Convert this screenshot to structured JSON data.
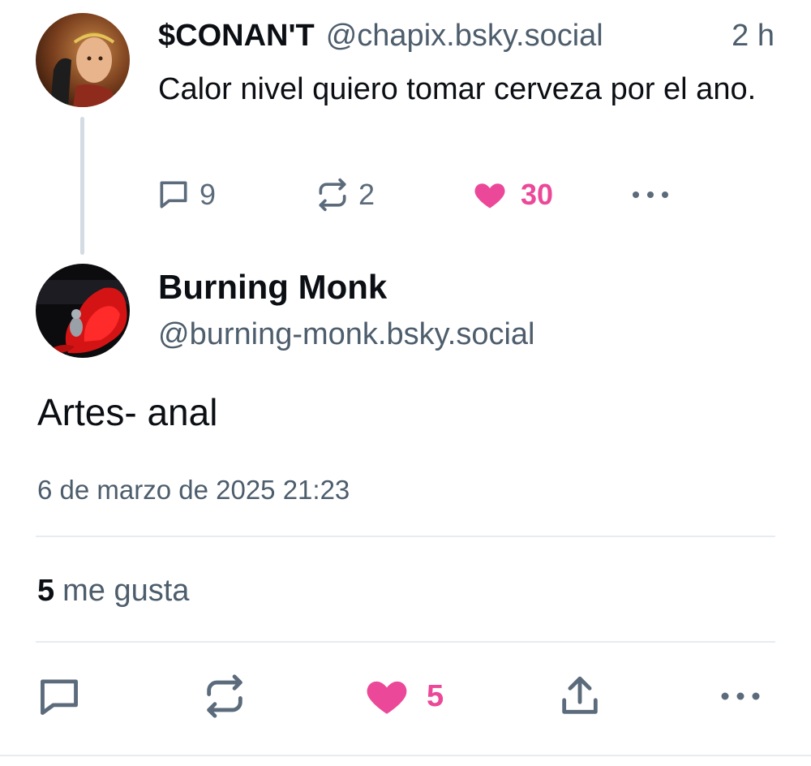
{
  "parent_post": {
    "display_name": "$CONAN'T",
    "handle": "@chapix.bsky.social",
    "time": "2 h",
    "text": "Calor nivel quiero tomar cerveza por el ano.",
    "reply_count": "9",
    "repost_count": "2",
    "like_count": "30",
    "liked": true
  },
  "main_post": {
    "display_name": "Burning Monk",
    "handle": "@burning-monk.bsky.social",
    "text": "Artes- anal",
    "datetime": "6 de marzo de 2025 21:23",
    "likes_count": "5",
    "likes_label": "me gusta",
    "action_like_count": "5",
    "liked": true
  },
  "icons": {
    "reply": "comment-bubble-icon",
    "repost": "repost-arrows-icon",
    "like": "heart-icon",
    "share": "share-upload-icon",
    "more": "more-dots-icon"
  },
  "colors": {
    "like_pink": "#ec4899",
    "muted_text": "#4d5d6c",
    "icon_gray": "#5b6b7b",
    "divider": "#e8ecf0"
  }
}
